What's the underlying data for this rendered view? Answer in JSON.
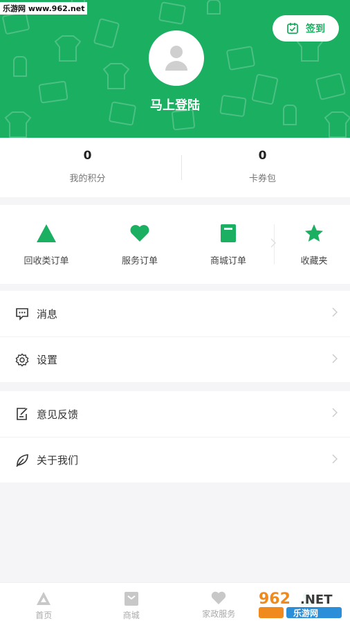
{
  "watermark": "乐游网 www.962.net",
  "header": {
    "checkin_label": "签到",
    "login_label": "马上登陆"
  },
  "stats": [
    {
      "value": "0",
      "label": "我的积分"
    },
    {
      "value": "0",
      "label": "卡券包"
    }
  ],
  "orders": [
    {
      "label": "回收类订单",
      "icon": "triangle-icon"
    },
    {
      "label": "服务订单",
      "icon": "heart-icon"
    },
    {
      "label": "商城订单",
      "icon": "book-icon"
    },
    {
      "label": "收藏夹",
      "icon": "star-icon"
    }
  ],
  "menu_group_1": [
    {
      "label": "消息",
      "icon": "message-icon"
    },
    {
      "label": "设置",
      "icon": "settings-icon"
    }
  ],
  "menu_group_2": [
    {
      "label": "意见反馈",
      "icon": "feedback-icon"
    },
    {
      "label": "关于我们",
      "icon": "leaf-icon"
    }
  ],
  "tabbar": [
    {
      "label": "首页",
      "icon": "home-icon"
    },
    {
      "label": "商城",
      "icon": "shop-icon"
    },
    {
      "label": "家政服务",
      "icon": "heart-icon"
    },
    {
      "label": "",
      "icon": "profile-icon"
    }
  ],
  "logo_badge": {
    "top": "962",
    "dot": ".NET",
    "bottom": "乐游网"
  },
  "colors": {
    "accent": "#1aaf61",
    "background": "#f5f5f7"
  }
}
